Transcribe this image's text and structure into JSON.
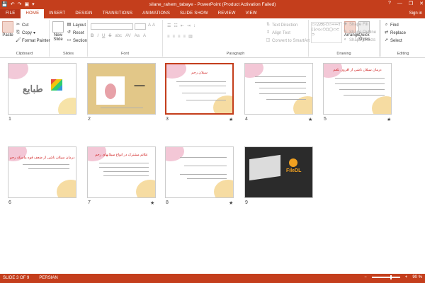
{
  "window": {
    "title": "silane_rahem_tabaye - PowerPoint (Product Activation Failed)",
    "help": "?",
    "minimize": "—",
    "restore": "❐",
    "close": "✕"
  },
  "qat": {
    "save": "💾",
    "undo": "↶",
    "redo": "↷",
    "start": "▣",
    "more": "▾"
  },
  "tabs": [
    {
      "label": "FILE"
    },
    {
      "label": "HOME"
    },
    {
      "label": "INSERT"
    },
    {
      "label": "DESIGN"
    },
    {
      "label": "TRANSITIONS"
    },
    {
      "label": "ANIMATIONS"
    },
    {
      "label": "SLIDE SHOW"
    },
    {
      "label": "REVIEW"
    },
    {
      "label": "VIEW"
    }
  ],
  "user": "Sign in",
  "ribbon": {
    "clipboard": {
      "label": "Clipboard",
      "paste": "Paste",
      "cut": "Cut",
      "copy": "Copy",
      "format_painter": "Format Painter"
    },
    "slides": {
      "label": "Slides",
      "new_slide": "New",
      "new_slide2": "Slide",
      "layout": "Layout",
      "reset": "Reset",
      "section": "Section"
    },
    "font": {
      "label": "Font",
      "grow": "A",
      "shrink": "A",
      "clear": "A",
      "bold": "B",
      "italic": "I",
      "underline": "U",
      "strike": "S",
      "shadow": "abc",
      "spacing": "AV",
      "case": "Aa",
      "color": "A"
    },
    "paragraph": {
      "label": "Paragraph",
      "text_direction": "Text Direction",
      "align_text": "Align Text",
      "smartart": "Convert to SmartArt"
    },
    "drawing": {
      "label": "Drawing",
      "arrange": "Arrange",
      "quick_styles": "Quick",
      "quick_styles2": "Styles",
      "shape_fill": "Shape Fill",
      "shape_outline": "Shape Outline",
      "shape_effects": "Shape Effects"
    },
    "editing": {
      "label": "Editing",
      "find": "Find",
      "replace": "Replace",
      "select": "Select"
    }
  },
  "slides": [
    {
      "num": "1",
      "star": "",
      "logo": "طبایع"
    },
    {
      "num": "2",
      "star": ""
    },
    {
      "num": "3",
      "star": "★",
      "title": "سیلان رحم"
    },
    {
      "num": "4",
      "star": "★"
    },
    {
      "num": "5",
      "star": "★",
      "title": "درمان سیلان ناشی از افزون بلغم"
    },
    {
      "num": "6",
      "star": "",
      "title": "درمان سیلان ناشی از ضعف قوه ماسکه رحم"
    },
    {
      "num": "7",
      "star": "★",
      "title": "علائم مشترک در انواع سیلانهای رحم"
    },
    {
      "num": "8",
      "star": "★"
    },
    {
      "num": "9",
      "star": "",
      "logo": "FileDL"
    }
  ],
  "status": {
    "slide_info": "SLIDE 3 OF 9",
    "language": "PERSIAN",
    "zoom": "90 %",
    "zoom_minus": "−",
    "zoom_plus": "+"
  },
  "colors": {
    "accent": "#c43e1c"
  }
}
